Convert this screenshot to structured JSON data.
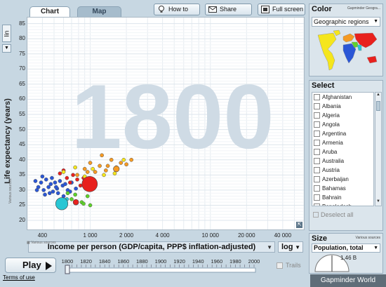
{
  "tabs": {
    "chart": "Chart",
    "map": "Map"
  },
  "toolbar": {
    "how_to_use": "How to use",
    "share_graph": "Share graph",
    "full_screen": "Full screen"
  },
  "y_axis": {
    "scale": "lin",
    "label": "Life expectancy (years)",
    "ticks": [
      "85",
      "80",
      "75",
      "70",
      "65",
      "60",
      "55",
      "50",
      "45",
      "40",
      "35",
      "30",
      "25",
      "20"
    ]
  },
  "x_axis": {
    "label": "Income per person (GDP/capita, PPP$ inflation-adjusted)",
    "scale": "log",
    "ticks": [
      "400",
      "1 000",
      "2 000",
      "4 000",
      "10 000",
      "20 000",
      "40 000"
    ]
  },
  "year_watermark": "1800",
  "various_sources": "Various sources",
  "play": {
    "label": "Play",
    "years": [
      "1800",
      "1820",
      "1840",
      "1860",
      "1880",
      "1900",
      "1920",
      "1940",
      "1960",
      "1980",
      "2000"
    ],
    "position": 0.0
  },
  "trails": "Trails",
  "footer": {
    "terms": "Terms of use",
    "brand": "Gapminder World"
  },
  "color_panel": {
    "title": "Color",
    "source": "Gapminder Geogra...",
    "selected": "Geographic regions",
    "region_colors": {
      "americas": "#f5e61c",
      "europe": "#f59a23",
      "africa": "#2a56d6",
      "asia": "#e8211e",
      "south_asia": "#28c6d4",
      "middle_east": "#5fd12a"
    }
  },
  "select_panel": {
    "title": "Select",
    "countries": [
      "Afghanistan",
      "Albania",
      "Algeria",
      "Angola",
      "Argentina",
      "Armenia",
      "Aruba",
      "Australia",
      "Austria",
      "Azerbaijan",
      "Bahamas",
      "Bahrain",
      "Bangladesh"
    ],
    "deselect": "Deselect all"
  },
  "size_panel": {
    "title": "Size",
    "source": "Various sources",
    "selected": "Population, total",
    "value": "1.46 B"
  },
  "chart_data": {
    "type": "scatter",
    "title": "",
    "xlabel": "Income per person (GDP/capita, PPP$ inflation-adjusted)",
    "ylabel": "Life expectancy (years)",
    "x_scale": "log",
    "xlim": [
      300,
      60000
    ],
    "ylim": [
      17,
      87
    ],
    "year": "1800",
    "series": [
      {
        "color": "#2a56d6",
        "points": [
          [
            350,
            33
          ],
          [
            370,
            31
          ],
          [
            390,
            32.5
          ],
          [
            410,
            30
          ],
          [
            430,
            33.5
          ],
          [
            450,
            31
          ],
          [
            470,
            32
          ],
          [
            490,
            29.5
          ],
          [
            510,
            32.5
          ],
          [
            530,
            30.5
          ],
          [
            560,
            33
          ],
          [
            590,
            31.5
          ],
          [
            620,
            32
          ],
          [
            650,
            30
          ],
          [
            700,
            32.5
          ],
          [
            360,
            30
          ],
          [
            420,
            28.5
          ],
          [
            480,
            34
          ],
          [
            540,
            29
          ],
          [
            600,
            28
          ],
          [
            680,
            29.5
          ],
          [
            760,
            30.5
          ],
          [
            400,
            34.5
          ],
          [
            460,
            29
          ],
          [
            520,
            31
          ]
        ]
      },
      {
        "color": "#e8211e",
        "points": [
          [
            640,
            34
          ],
          [
            680,
            32.5
          ],
          [
            720,
            35
          ],
          [
            780,
            33.5
          ],
          [
            830,
            31.5
          ],
          [
            880,
            34
          ],
          [
            940,
            33
          ],
          [
            1000,
            32
          ],
          [
            560,
            35.5
          ],
          [
            600,
            36.5
          ]
        ]
      },
      {
        "color": "#f59a23",
        "points": [
          [
            780,
            35
          ],
          [
            900,
            37
          ],
          [
            1000,
            39
          ],
          [
            1100,
            36
          ],
          [
            1200,
            38
          ],
          [
            1350,
            36.5
          ],
          [
            1500,
            40
          ],
          [
            1650,
            37.5
          ],
          [
            1800,
            39
          ],
          [
            2000,
            38.5
          ],
          [
            2200,
            40
          ],
          [
            1250,
            41.5
          ],
          [
            1400,
            38
          ],
          [
            950,
            36
          ]
        ]
      },
      {
        "color": "#f5e61c",
        "points": [
          [
            600,
            36
          ],
          [
            750,
            37.5
          ],
          [
            900,
            34.5
          ],
          [
            1050,
            37
          ],
          [
            1300,
            35
          ],
          [
            1600,
            35.5
          ],
          [
            1900,
            40
          ]
        ]
      },
      {
        "color": "#5fd12a",
        "points": [
          [
            650,
            29
          ],
          [
            700,
            27
          ],
          [
            850,
            26
          ],
          [
            880,
            25.5
          ],
          [
            1000,
            25
          ],
          [
            750,
            28.5
          ],
          [
            950,
            28
          ]
        ]
      },
      {
        "color": "#28c6d4",
        "points": [
          [
            560,
            25.5
          ],
          [
            640,
            27
          ]
        ]
      }
    ],
    "highlights": [
      {
        "label": "",
        "color": "#e8211e",
        "x": 990,
        "y": 32,
        "population_weight": 1.0
      },
      {
        "label": "",
        "color": "#28c6d4",
        "x": 580,
        "y": 25.5,
        "population_weight": 0.75
      },
      {
        "label": "",
        "color": "#e8211e",
        "x": 760,
        "y": 26,
        "population_weight": 0.22
      },
      {
        "label": "",
        "color": "#f59a23",
        "x": 1650,
        "y": 37,
        "population_weight": 0.25
      }
    ]
  }
}
